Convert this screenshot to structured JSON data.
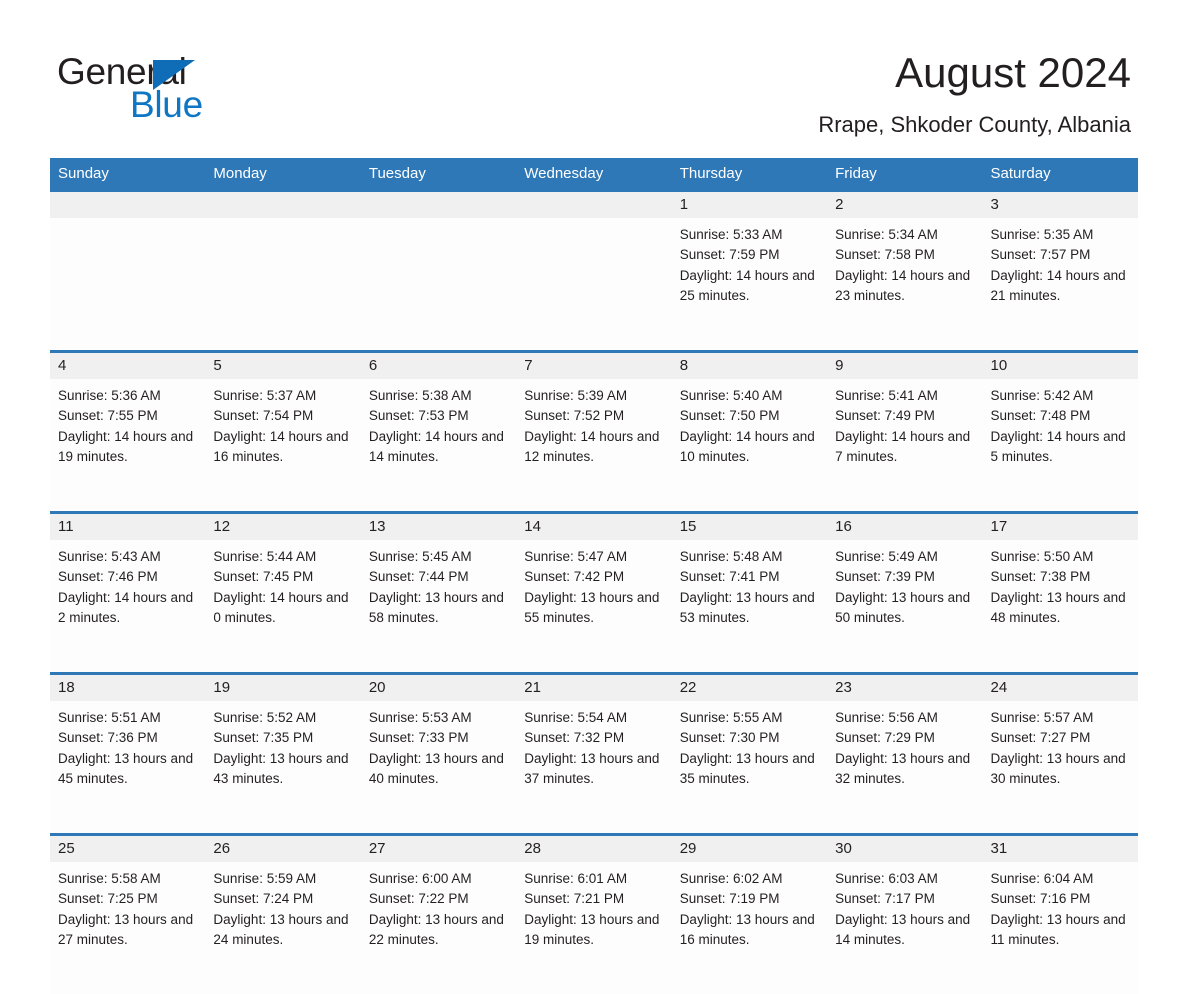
{
  "brand": {
    "name_part1": "General",
    "name_part2": "Blue",
    "accent_color": "#0f76c3",
    "triangle_color": "#0f6cb6"
  },
  "header": {
    "title": "August 2024",
    "subtitle": "Rrape, Shkoder County, Albania"
  },
  "calendar": {
    "header_color": "#2e78b8",
    "weekdays": [
      "Sunday",
      "Monday",
      "Tuesday",
      "Wednesday",
      "Thursday",
      "Friday",
      "Saturday"
    ],
    "weeks": [
      [
        {
          "day": "",
          "sunrise": "",
          "sunset": "",
          "daylight": ""
        },
        {
          "day": "",
          "sunrise": "",
          "sunset": "",
          "daylight": ""
        },
        {
          "day": "",
          "sunrise": "",
          "sunset": "",
          "daylight": ""
        },
        {
          "day": "",
          "sunrise": "",
          "sunset": "",
          "daylight": ""
        },
        {
          "day": "1",
          "sunrise": "Sunrise: 5:33 AM",
          "sunset": "Sunset: 7:59 PM",
          "daylight": "Daylight: 14 hours and 25 minutes."
        },
        {
          "day": "2",
          "sunrise": "Sunrise: 5:34 AM",
          "sunset": "Sunset: 7:58 PM",
          "daylight": "Daylight: 14 hours and 23 minutes."
        },
        {
          "day": "3",
          "sunrise": "Sunrise: 5:35 AM",
          "sunset": "Sunset: 7:57 PM",
          "daylight": "Daylight: 14 hours and 21 minutes."
        }
      ],
      [
        {
          "day": "4",
          "sunrise": "Sunrise: 5:36 AM",
          "sunset": "Sunset: 7:55 PM",
          "daylight": "Daylight: 14 hours and 19 minutes."
        },
        {
          "day": "5",
          "sunrise": "Sunrise: 5:37 AM",
          "sunset": "Sunset: 7:54 PM",
          "daylight": "Daylight: 14 hours and 16 minutes."
        },
        {
          "day": "6",
          "sunrise": "Sunrise: 5:38 AM",
          "sunset": "Sunset: 7:53 PM",
          "daylight": "Daylight: 14 hours and 14 minutes."
        },
        {
          "day": "7",
          "sunrise": "Sunrise: 5:39 AM",
          "sunset": "Sunset: 7:52 PM",
          "daylight": "Daylight: 14 hours and 12 minutes."
        },
        {
          "day": "8",
          "sunrise": "Sunrise: 5:40 AM",
          "sunset": "Sunset: 7:50 PM",
          "daylight": "Daylight: 14 hours and 10 minutes."
        },
        {
          "day": "9",
          "sunrise": "Sunrise: 5:41 AM",
          "sunset": "Sunset: 7:49 PM",
          "daylight": "Daylight: 14 hours and 7 minutes."
        },
        {
          "day": "10",
          "sunrise": "Sunrise: 5:42 AM",
          "sunset": "Sunset: 7:48 PM",
          "daylight": "Daylight: 14 hours and 5 minutes."
        }
      ],
      [
        {
          "day": "11",
          "sunrise": "Sunrise: 5:43 AM",
          "sunset": "Sunset: 7:46 PM",
          "daylight": "Daylight: 14 hours and 2 minutes."
        },
        {
          "day": "12",
          "sunrise": "Sunrise: 5:44 AM",
          "sunset": "Sunset: 7:45 PM",
          "daylight": "Daylight: 14 hours and 0 minutes."
        },
        {
          "day": "13",
          "sunrise": "Sunrise: 5:45 AM",
          "sunset": "Sunset: 7:44 PM",
          "daylight": "Daylight: 13 hours and 58 minutes."
        },
        {
          "day": "14",
          "sunrise": "Sunrise: 5:47 AM",
          "sunset": "Sunset: 7:42 PM",
          "daylight": "Daylight: 13 hours and 55 minutes."
        },
        {
          "day": "15",
          "sunrise": "Sunrise: 5:48 AM",
          "sunset": "Sunset: 7:41 PM",
          "daylight": "Daylight: 13 hours and 53 minutes."
        },
        {
          "day": "16",
          "sunrise": "Sunrise: 5:49 AM",
          "sunset": "Sunset: 7:39 PM",
          "daylight": "Daylight: 13 hours and 50 minutes."
        },
        {
          "day": "17",
          "sunrise": "Sunrise: 5:50 AM",
          "sunset": "Sunset: 7:38 PM",
          "daylight": "Daylight: 13 hours and 48 minutes."
        }
      ],
      [
        {
          "day": "18",
          "sunrise": "Sunrise: 5:51 AM",
          "sunset": "Sunset: 7:36 PM",
          "daylight": "Daylight: 13 hours and 45 minutes."
        },
        {
          "day": "19",
          "sunrise": "Sunrise: 5:52 AM",
          "sunset": "Sunset: 7:35 PM",
          "daylight": "Daylight: 13 hours and 43 minutes."
        },
        {
          "day": "20",
          "sunrise": "Sunrise: 5:53 AM",
          "sunset": "Sunset: 7:33 PM",
          "daylight": "Daylight: 13 hours and 40 minutes."
        },
        {
          "day": "21",
          "sunrise": "Sunrise: 5:54 AM",
          "sunset": "Sunset: 7:32 PM",
          "daylight": "Daylight: 13 hours and 37 minutes."
        },
        {
          "day": "22",
          "sunrise": "Sunrise: 5:55 AM",
          "sunset": "Sunset: 7:30 PM",
          "daylight": "Daylight: 13 hours and 35 minutes."
        },
        {
          "day": "23",
          "sunrise": "Sunrise: 5:56 AM",
          "sunset": "Sunset: 7:29 PM",
          "daylight": "Daylight: 13 hours and 32 minutes."
        },
        {
          "day": "24",
          "sunrise": "Sunrise: 5:57 AM",
          "sunset": "Sunset: 7:27 PM",
          "daylight": "Daylight: 13 hours and 30 minutes."
        }
      ],
      [
        {
          "day": "25",
          "sunrise": "Sunrise: 5:58 AM",
          "sunset": "Sunset: 7:25 PM",
          "daylight": "Daylight: 13 hours and 27 minutes."
        },
        {
          "day": "26",
          "sunrise": "Sunrise: 5:59 AM",
          "sunset": "Sunset: 7:24 PM",
          "daylight": "Daylight: 13 hours and 24 minutes."
        },
        {
          "day": "27",
          "sunrise": "Sunrise: 6:00 AM",
          "sunset": "Sunset: 7:22 PM",
          "daylight": "Daylight: 13 hours and 22 minutes."
        },
        {
          "day": "28",
          "sunrise": "Sunrise: 6:01 AM",
          "sunset": "Sunset: 7:21 PM",
          "daylight": "Daylight: 13 hours and 19 minutes."
        },
        {
          "day": "29",
          "sunrise": "Sunrise: 6:02 AM",
          "sunset": "Sunset: 7:19 PM",
          "daylight": "Daylight: 13 hours and 16 minutes."
        },
        {
          "day": "30",
          "sunrise": "Sunrise: 6:03 AM",
          "sunset": "Sunset: 7:17 PM",
          "daylight": "Daylight: 13 hours and 14 minutes."
        },
        {
          "day": "31",
          "sunrise": "Sunrise: 6:04 AM",
          "sunset": "Sunset: 7:16 PM",
          "daylight": "Daylight: 13 hours and 11 minutes."
        }
      ]
    ]
  }
}
